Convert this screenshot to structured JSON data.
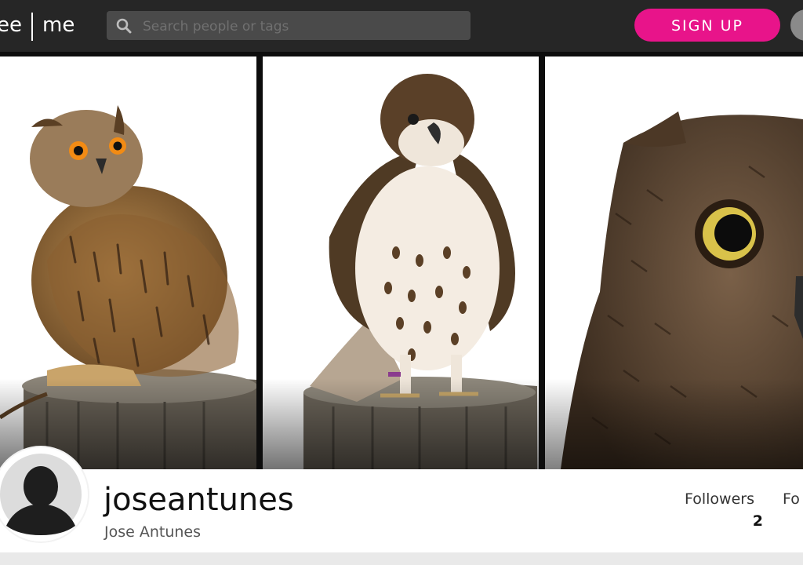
{
  "header": {
    "logo_left": "ee",
    "logo_right": "me",
    "search": {
      "placeholder": "Search people or tags",
      "value": ""
    },
    "signup_label": "SIGN UP",
    "accent_color": "#e8148a"
  },
  "cover": {
    "photos": [
      {
        "subject": "eagle owl on tree stump"
      },
      {
        "subject": "red-tailed hawk on tree stump"
      },
      {
        "subject": "owl face close-up"
      }
    ]
  },
  "profile": {
    "username": "joseantunes",
    "full_name": "Jose Antunes",
    "stats": [
      {
        "label": "Followers",
        "count": "2"
      },
      {
        "label": "Fo",
        "count": ""
      }
    ]
  }
}
